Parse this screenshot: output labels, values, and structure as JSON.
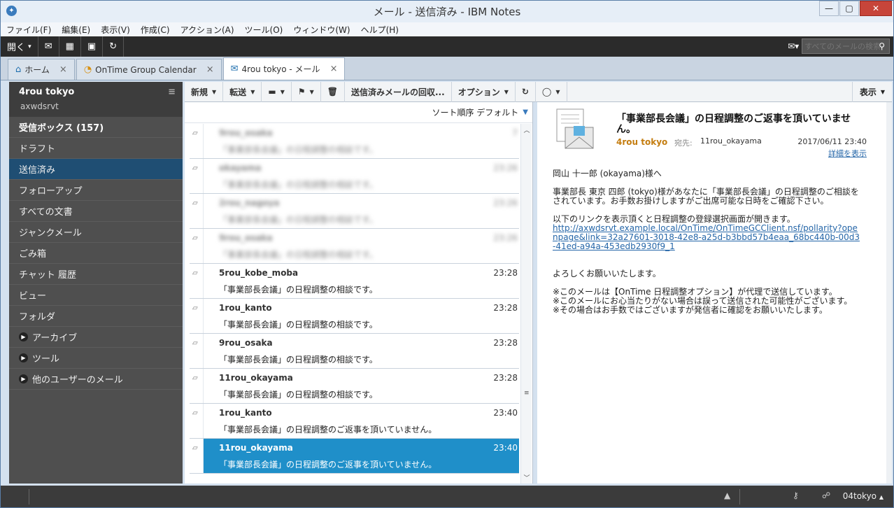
{
  "window": {
    "title": "メール - 送信済み - IBM Notes"
  },
  "menubar": [
    "ファイル(F)",
    "編集(E)",
    "表示(V)",
    "作成(C)",
    "アクション(A)",
    "ツール(O)",
    "ウィンドウ(W)",
    "ヘルプ(H)"
  ],
  "toolbar": {
    "open_label": "開く",
    "search_placeholder": "すべてのメールの検索"
  },
  "tabs": [
    {
      "label": "ホーム",
      "icon": "home-icon"
    },
    {
      "label": "OnTime Group Calendar",
      "icon": "calendar-icon"
    },
    {
      "label": "4rou tokyo - メール",
      "icon": "mail-icon"
    }
  ],
  "sidebar": {
    "title": "4rou tokyo",
    "server": "axwdsrvt",
    "items": [
      {
        "label": "受信ボックス (157)"
      },
      {
        "label": "ドラフト"
      },
      {
        "label": "送信済み"
      },
      {
        "label": "フォローアップ"
      },
      {
        "label": "すべての文書"
      },
      {
        "label": "ジャンクメール"
      },
      {
        "label": "ごみ箱"
      },
      {
        "label": "チャット 履歴"
      },
      {
        "label": "ビュー"
      },
      {
        "label": "フォルダ"
      },
      {
        "label": "アーカイブ"
      },
      {
        "label": "ツール"
      },
      {
        "label": "他のユーザーのメール"
      }
    ]
  },
  "actions": {
    "new": "新規",
    "forward": "転送",
    "recall": "送信済みメールの回収...",
    "options": "オプション",
    "view": "表示"
  },
  "list": {
    "sort_label": "ソート順序 デフォルト",
    "rows": [
      {
        "from": "9rou_osaka",
        "time": "7",
        "subject": "「事業部長会議」の日程調整の相談です。",
        "blurred": true
      },
      {
        "from": "okayama",
        "time": "23:26",
        "subject": "「事業部長会議」の日程調整の相談です。",
        "blurred": true
      },
      {
        "from": "2rou_nagoya",
        "time": "23:26",
        "subject": "「事業部長会議」の日程調整の相談です。",
        "blurred": true
      },
      {
        "from": "9rou_osaka",
        "time": "23:26",
        "subject": "「事業部長会議」の日程調整の相談です。",
        "blurred": true
      },
      {
        "from": "5rou_kobe_moba",
        "time": "23:28",
        "subject": "「事業部長会議」の日程調整の相談です。",
        "blurred": false
      },
      {
        "from": "1rou_kanto",
        "time": "23:28",
        "subject": "「事業部長会議」の日程調整の相談です。",
        "blurred": false
      },
      {
        "from": "9rou_osaka",
        "time": "23:28",
        "subject": "「事業部長会議」の日程調整の相談です。",
        "blurred": false
      },
      {
        "from": "11rou_okayama",
        "time": "23:28",
        "subject": "「事業部長会議」の日程調整の相談です。",
        "blurred": false
      },
      {
        "from": "1rou_kanto",
        "time": "23:40",
        "subject": "「事業部長会議」の日程調整のご返事を頂いていません。",
        "blurred": false
      },
      {
        "from": "11rou_okayama",
        "time": "23:40",
        "subject": "「事業部長会議」の日程調整のご返事を頂いていません。",
        "blurred": false,
        "selected": true
      }
    ]
  },
  "reader": {
    "subject": "「事業部長会議」の日程調整のご返事を頂いていません。",
    "from": "4rou tokyo",
    "to_label": "宛先:",
    "to": "11rou_okayama",
    "date": "2017/06/11 23:40",
    "detail_link": "詳細を表示",
    "greeting": "岡山 十一郎 (okayama)様へ",
    "para1": "事業部長 東京 四郎 (tokyo)様があなたに「事業部長会議」の日程調整のご相談をされています。お手数お掛けしますがご出席可能な日時をご確認下さい。",
    "para2": "以下のリンクを表示頂くと日程調整の登録選択画面が開きます。",
    "link": "http://axwdsrvt.example.local/OnTime/OnTimeGCClient.nsf/pollarity?openpage&link=32a27601-3018-42e8-a25d-b3bbd57b4eaa_68bc440b-00d3-41ed-a94a-453edb2930f9_1",
    "closing": "よろしくお願いいたします。",
    "note1": "※このメールは【OnTime 日程調整オプション】が代理で送信しています。",
    "note2": "※このメールにお心当たりがない場合は誤って送信された可能性がございます。",
    "note3": "※その場合はお手数ではございますが発信者に確認をお願いいたします。"
  },
  "status": {
    "user": "04tokyo"
  }
}
